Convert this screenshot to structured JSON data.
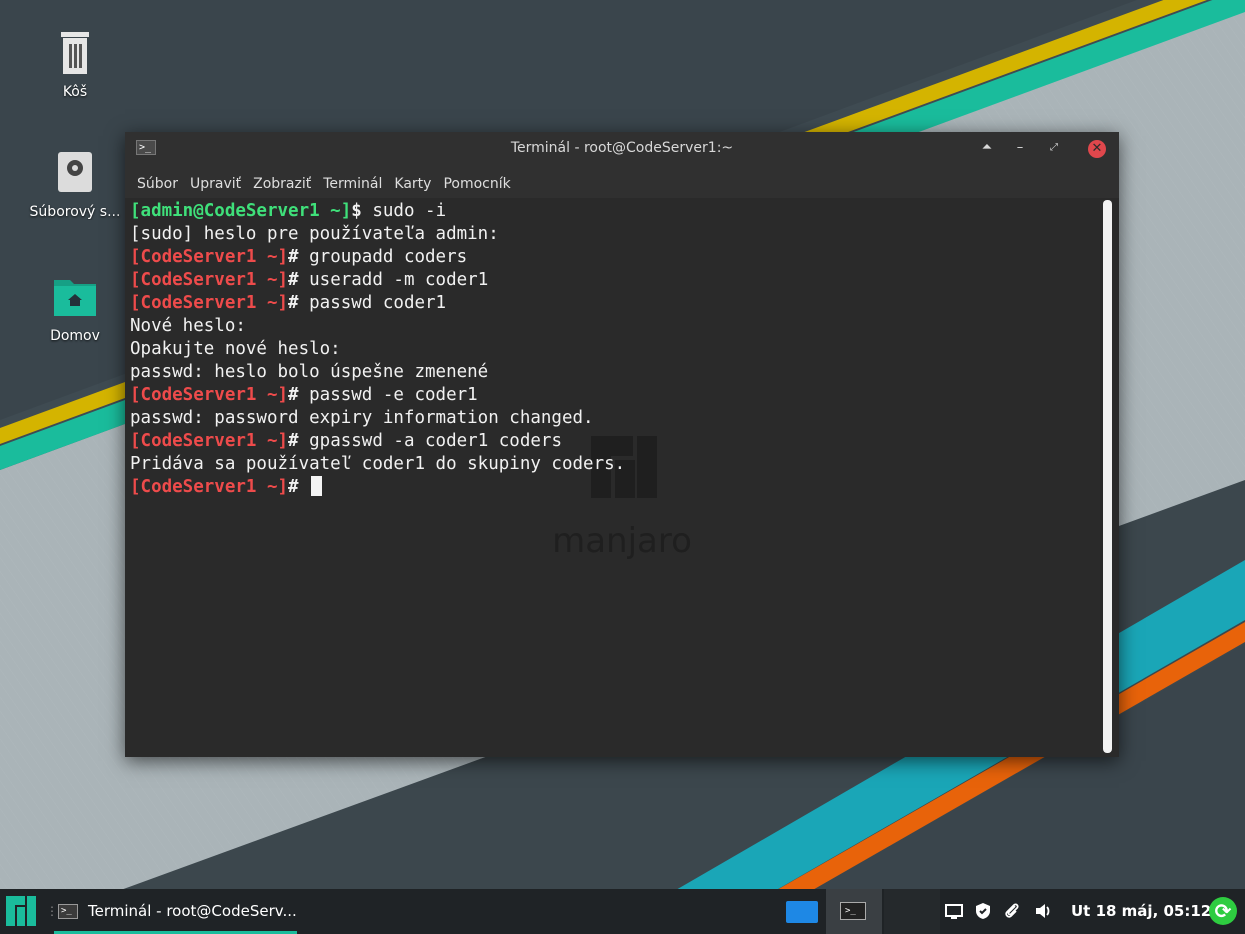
{
  "desktop": {
    "icons": [
      {
        "label": "Kôš",
        "icon": "trash-icon"
      },
      {
        "label": "Súborový s...",
        "icon": "drive-icon"
      },
      {
        "label": "Domov",
        "icon": "home-folder-icon"
      }
    ],
    "colors": {
      "teal": "#1abc9c",
      "yellow": "#d4b400",
      "orange": "#e8630a",
      "dark": "#3a454c"
    }
  },
  "window": {
    "title": "Terminál - root@CodeServer1:~",
    "menu": [
      "Súbor",
      "Upraviť",
      "Zobraziť",
      "Terminál",
      "Karty",
      "Pomocník"
    ],
    "watermark": "manjaro",
    "lines": [
      {
        "prompt": "[admin@CodeServer1 ~]$",
        "style": "green",
        "cmd": " sudo -i"
      },
      {
        "prompt": "",
        "style": "",
        "cmd": "[sudo] heslo pre používateľa admin:"
      },
      {
        "prompt": "[CodeServer1 ~]#",
        "style": "red",
        "cmd": " groupadd coders"
      },
      {
        "prompt": "[CodeServer1 ~]#",
        "style": "red",
        "cmd": " useradd -m coder1"
      },
      {
        "prompt": "[CodeServer1 ~]#",
        "style": "red",
        "cmd": " passwd coder1"
      },
      {
        "prompt": "",
        "style": "",
        "cmd": "Nové heslo:"
      },
      {
        "prompt": "",
        "style": "",
        "cmd": "Opakujte nové heslo:"
      },
      {
        "prompt": "",
        "style": "",
        "cmd": "passwd: heslo bolo úspešne zmenené"
      },
      {
        "prompt": "[CodeServer1 ~]#",
        "style": "red",
        "cmd": " passwd -e coder1"
      },
      {
        "prompt": "",
        "style": "",
        "cmd": "passwd: password expiry information changed."
      },
      {
        "prompt": "[CodeServer1 ~]#",
        "style": "red",
        "cmd": " gpasswd -a coder1 coders"
      },
      {
        "prompt": "",
        "style": "",
        "cmd": "Pridáva sa používateľ coder1 do skupiny coders."
      },
      {
        "prompt": "[CodeServer1 ~]#",
        "style": "red",
        "cmd": " ",
        "cursor": true
      }
    ]
  },
  "taskbar": {
    "task_label": "Terminál - root@CodeServ...",
    "clock": "Ut 18 máj, 05:12",
    "tray_icons": [
      "display-icon",
      "shield-icon",
      "paperclip-icon",
      "volume-icon",
      "update-icon"
    ]
  }
}
